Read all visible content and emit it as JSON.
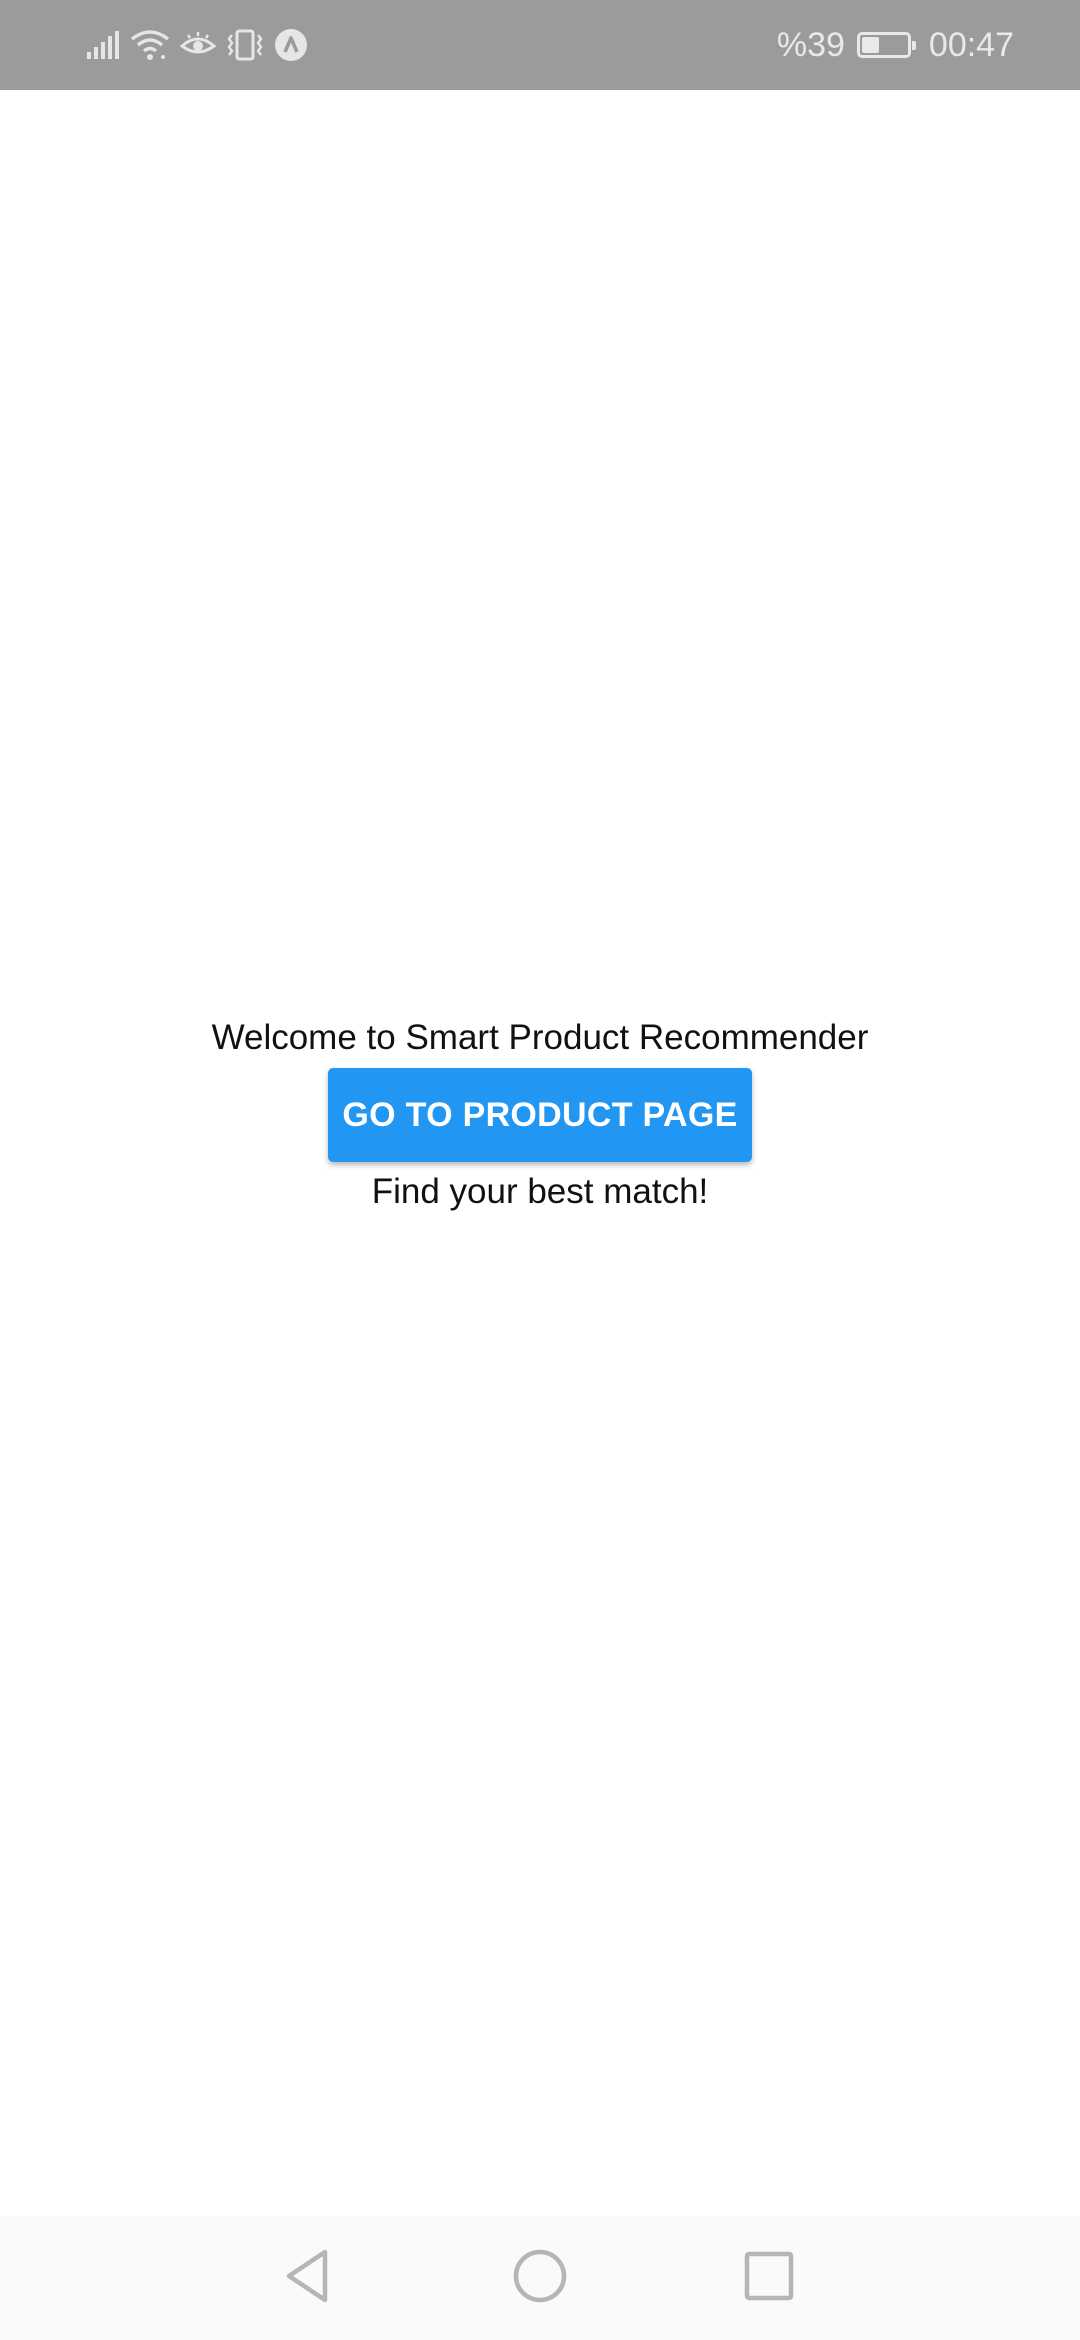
{
  "status_bar": {
    "battery_text": "%39",
    "battery_level": 0.39,
    "time": "00:47",
    "icons": [
      "signal-icon",
      "wifi-icon",
      "eye-comfort-icon",
      "vibrate-icon",
      "app-notification-icon",
      "battery-icon"
    ]
  },
  "main": {
    "welcome_text": "Welcome to Smart Product Recommender",
    "button_label": "GO TO PRODUCT PAGE",
    "tagline": "Find your best match!"
  },
  "nav_bar": {
    "icons": [
      "back-icon",
      "home-icon",
      "recents-icon"
    ]
  },
  "colors": {
    "status_bar_bg": "#9b9b9b",
    "button_bg": "#2196f3",
    "button_text": "#ffffff",
    "text": "#111111",
    "nav_bar_bg": "#fafafa",
    "nav_icon": "#b5b5b5"
  }
}
